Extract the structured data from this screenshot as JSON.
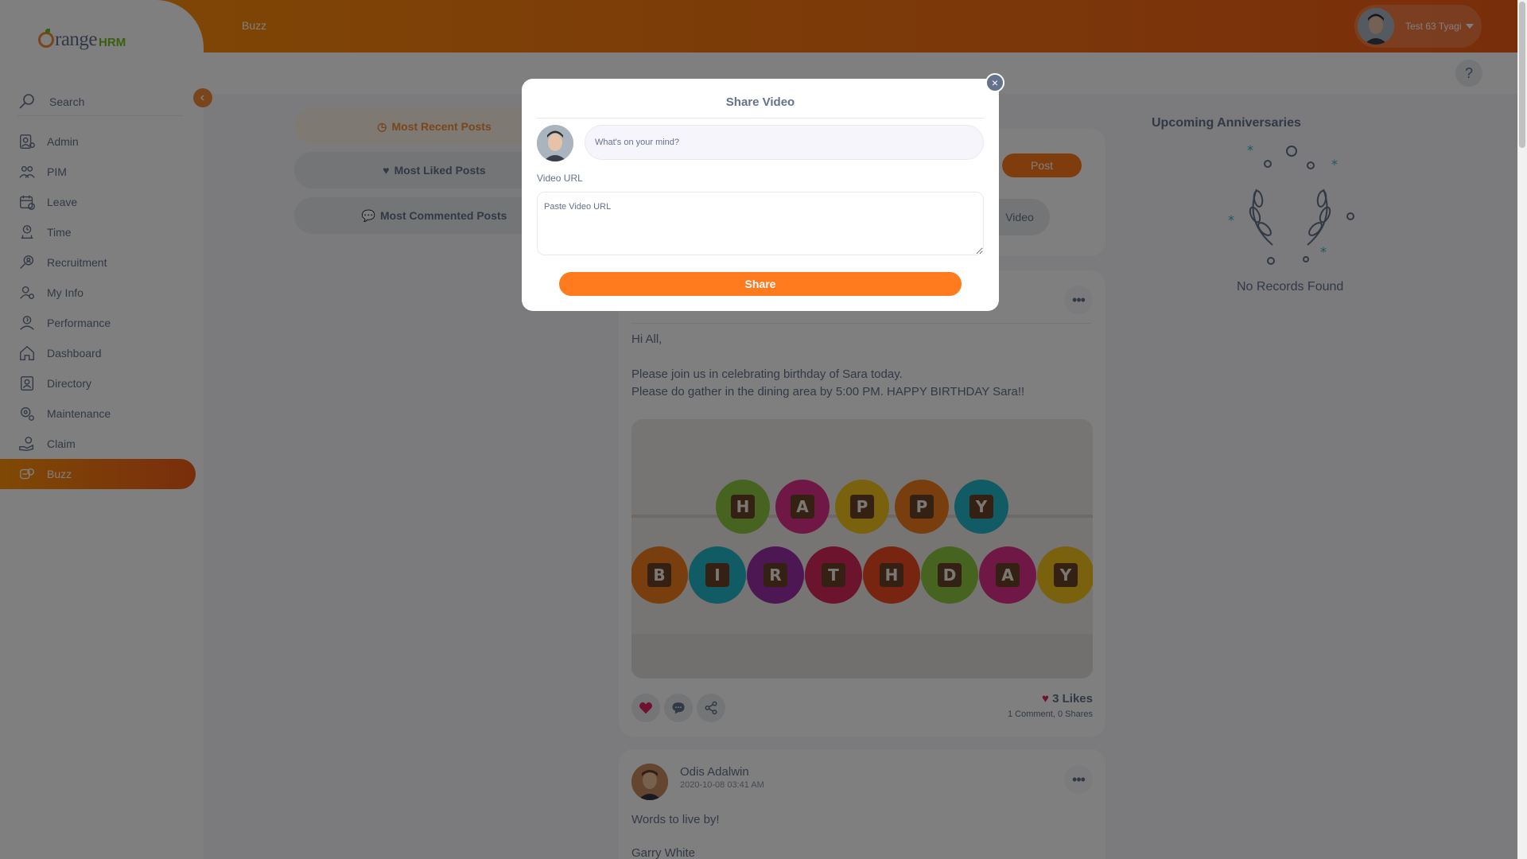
{
  "brand": {
    "name": "range",
    "suffix": "HRM"
  },
  "topbar": {
    "module_title": "Buzz",
    "user_name": "Test 63 Tyagi"
  },
  "sidebar": {
    "search_label": "Search",
    "items": [
      {
        "label": "Admin",
        "icon": "admin-icon"
      },
      {
        "label": "PIM",
        "icon": "pim-icon"
      },
      {
        "label": "Leave",
        "icon": "leave-icon"
      },
      {
        "label": "Time",
        "icon": "time-icon"
      },
      {
        "label": "Recruitment",
        "icon": "recruitment-icon"
      },
      {
        "label": "My Info",
        "icon": "my-info-icon"
      },
      {
        "label": "Performance",
        "icon": "performance-icon"
      },
      {
        "label": "Dashboard",
        "icon": "dashboard-icon"
      },
      {
        "label": "Directory",
        "icon": "directory-icon"
      },
      {
        "label": "Maintenance",
        "icon": "maintenance-icon"
      },
      {
        "label": "Claim",
        "icon": "claim-icon"
      },
      {
        "label": "Buzz",
        "icon": "buzz-icon",
        "active": true
      }
    ]
  },
  "help": {
    "label": "?"
  },
  "filters": [
    {
      "label": "Most Recent Posts",
      "active": true
    },
    {
      "label": "Most Liked Posts"
    },
    {
      "label": "Most Commented Posts"
    }
  ],
  "composer": {
    "post_label": "Post",
    "share_video_fragment": "Video"
  },
  "post1": {
    "lines": [
      "Hi All,",
      "Please join us in celebrating birthday of Sara today.",
      "Please do gather in the dining area by 5:00 PM. HAPPY BIRTHDAY Sara!!"
    ],
    "image_top_letters": [
      "H",
      "A",
      "P",
      "P",
      "Y"
    ],
    "image_bottom_letters": [
      "B",
      "I",
      "R",
      "T",
      "H",
      "D",
      "A",
      "Y"
    ],
    "likes": "3 Likes",
    "comments": "1 Comment",
    "shares": "0 Shares"
  },
  "post2": {
    "author": "Odis Adalwin",
    "date": "2020-10-08 03:41 AM",
    "text_line1": "Words to live by!",
    "text_line2": "Garry  White"
  },
  "anniversaries": {
    "title": "Upcoming Anniversaries",
    "empty_text": "No Records Found"
  },
  "modal": {
    "title": "Share Video",
    "close_label": "×",
    "mind_placeholder": "What's on your mind?",
    "video_url_label": "Video URL",
    "video_url_placeholder": "Paste Video URL",
    "share_label": "Share"
  },
  "colors": {
    "accent": "#ff7b1d",
    "accent_dark": "#f35c17",
    "text": "#64728c",
    "brand_green": "#76bc21"
  }
}
